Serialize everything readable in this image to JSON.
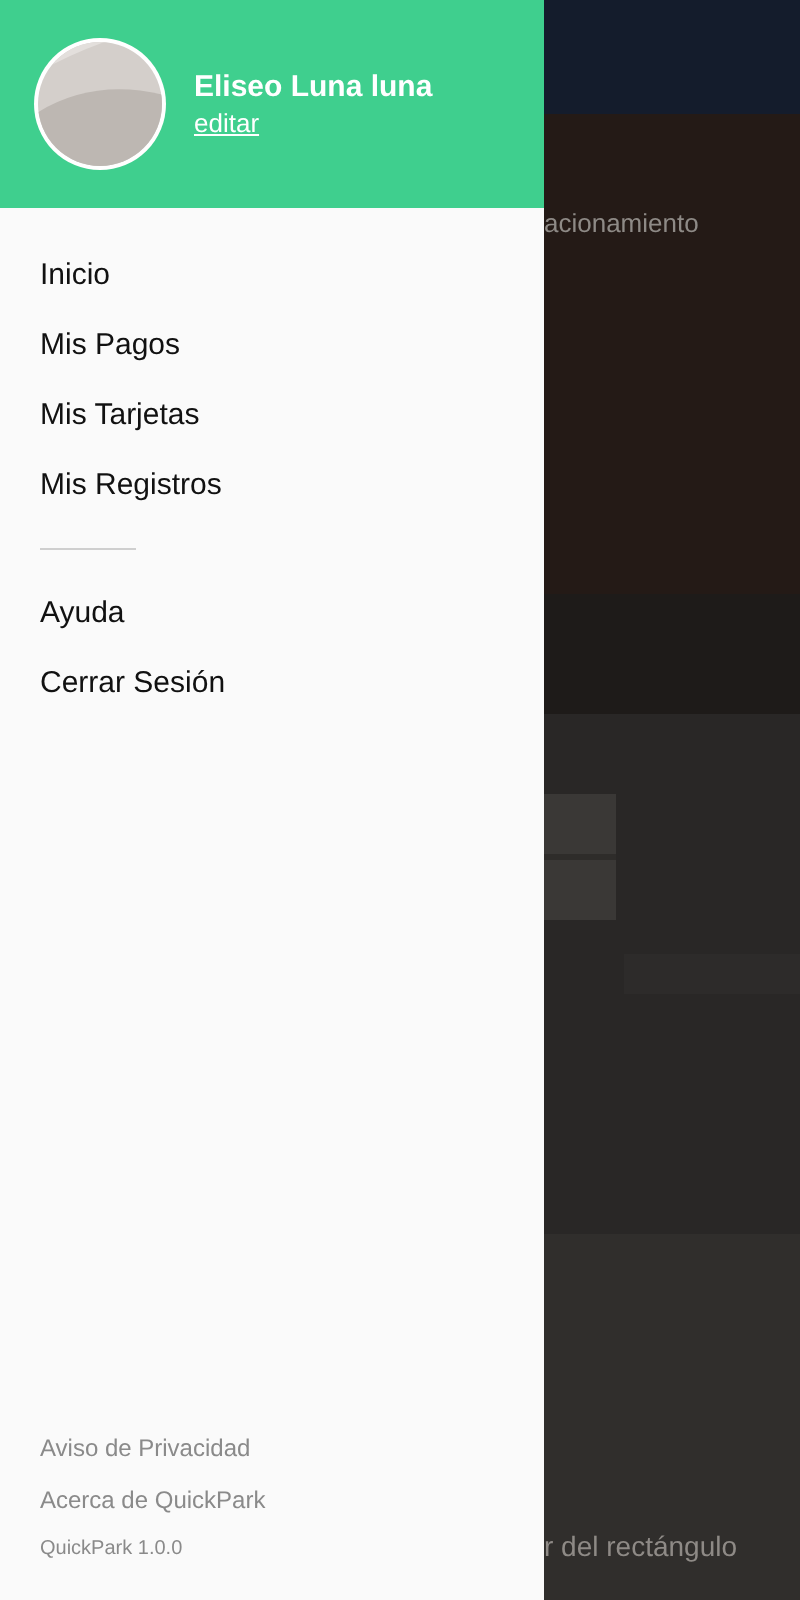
{
  "drawer": {
    "profile": {
      "name": "Eliseo Luna luna",
      "edit_link": "editar"
    },
    "menu_groups": [
      [
        "Inicio",
        "Mis Pagos",
        "Mis Tarjetas",
        "Mis Registros"
      ],
      [
        "Ayuda",
        "Cerrar Sesión"
      ]
    ],
    "footer_links": [
      "Aviso de Privacidad",
      "Acerca de QuickPark"
    ],
    "version": "QuickPark 1.0.0"
  },
  "background_screen": {
    "heading_fragment": "acionamiento",
    "hint_fragment": "r del rectángulo"
  }
}
